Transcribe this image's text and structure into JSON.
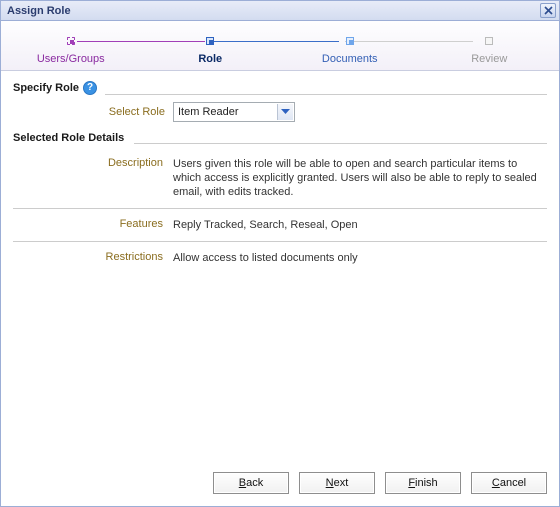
{
  "dialog": {
    "title": "Assign Role"
  },
  "wizard": {
    "steps": [
      {
        "label": "Users/Groups"
      },
      {
        "label": "Role"
      },
      {
        "label": "Documents"
      },
      {
        "label": "Review"
      }
    ]
  },
  "sections": {
    "specify_role": "Specify Role",
    "selected_role_details": "Selected Role Details"
  },
  "form": {
    "select_role_label": "Select Role",
    "select_role_value": "Item Reader"
  },
  "details": {
    "description_label": "Description",
    "description_value": "Users given this role will be able to open and search particular items to which access is explicitly granted. Users will also be able to reply to sealed email, with edits tracked.",
    "features_label": "Features",
    "features_value": "Reply Tracked, Search, Reseal, Open",
    "restrictions_label": "Restrictions",
    "restrictions_value": "Allow access to listed documents only"
  },
  "buttons": {
    "back": "Back",
    "next": "Next",
    "finish": "Finish",
    "cancel": "Cancel"
  }
}
